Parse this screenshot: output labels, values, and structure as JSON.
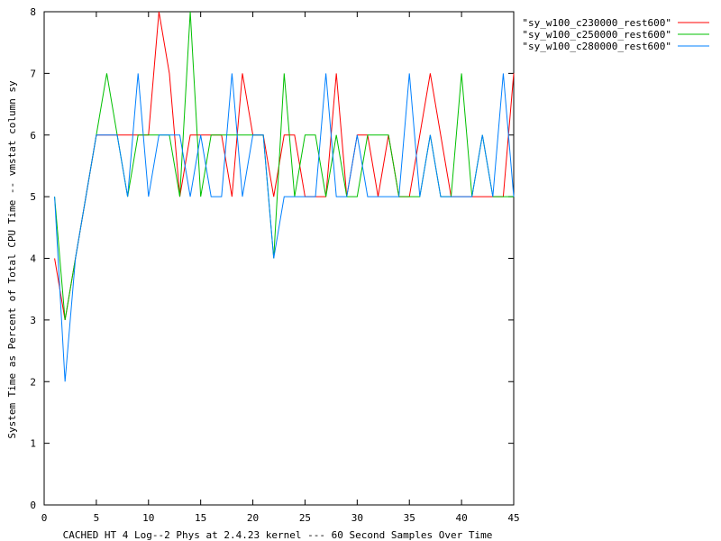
{
  "chart_data": {
    "type": "line",
    "title": "",
    "xlabel": "CACHED HT 4 Log--2 Phys at 2.4.23 kernel --- 60 Second Samples Over Time",
    "ylabel": "System Time as Percent of Total CPU Time -- vmstat column sy",
    "xlim": [
      0,
      45
    ],
    "ylim": [
      0,
      8
    ],
    "xticks": [
      0,
      5,
      10,
      15,
      20,
      25,
      30,
      35,
      40,
      45
    ],
    "yticks": [
      0,
      1,
      2,
      3,
      4,
      5,
      6,
      7,
      8
    ],
    "grid": false,
    "legend_position": "top-right",
    "x": [
      1,
      2,
      3,
      4,
      5,
      6,
      7,
      8,
      9,
      10,
      11,
      12,
      13,
      14,
      15,
      16,
      17,
      18,
      19,
      20,
      21,
      22,
      23,
      24,
      25,
      26,
      27,
      28,
      29,
      30,
      31,
      32,
      33,
      34,
      35,
      36,
      37,
      38,
      39,
      40,
      41,
      42,
      43,
      44,
      45
    ],
    "series": [
      {
        "name": "\"sy_w100_c230000_rest600\"",
        "color": "#ff0000",
        "values": [
          4,
          3,
          4,
          5,
          6,
          6,
          6,
          6,
          6,
          6,
          8,
          7,
          5,
          6,
          6,
          6,
          6,
          5,
          7,
          6,
          6,
          5,
          6,
          6,
          5,
          5,
          5,
          7,
          5,
          6,
          6,
          5,
          6,
          5,
          5,
          6,
          7,
          6,
          5,
          5,
          5,
          5,
          5,
          5,
          7
        ]
      },
      {
        "name": "\"sy_w100_c250000_rest600\"",
        "color": "#00c000",
        "values": [
          5,
          3,
          4,
          5,
          6,
          7,
          6,
          5,
          6,
          6,
          6,
          6,
          5,
          8,
          5,
          6,
          6,
          6,
          6,
          6,
          6,
          4,
          7,
          5,
          6,
          6,
          5,
          6,
          5,
          5,
          6,
          6,
          6,
          5,
          5,
          5,
          6,
          5,
          5,
          7,
          5,
          6,
          5,
          5,
          5
        ]
      },
      {
        "name": "\"sy_w100_c280000_rest600\"",
        "color": "#0080ff",
        "values": [
          5,
          2,
          4,
          5,
          6,
          6,
          6,
          5,
          7,
          5,
          6,
          6,
          6,
          5,
          6,
          5,
          5,
          7,
          5,
          6,
          6,
          4,
          5,
          5,
          5,
          5,
          7,
          5,
          5,
          6,
          5,
          5,
          5,
          5,
          7,
          5,
          6,
          5,
          5,
          5,
          5,
          6,
          5,
          7,
          5
        ]
      }
    ]
  }
}
